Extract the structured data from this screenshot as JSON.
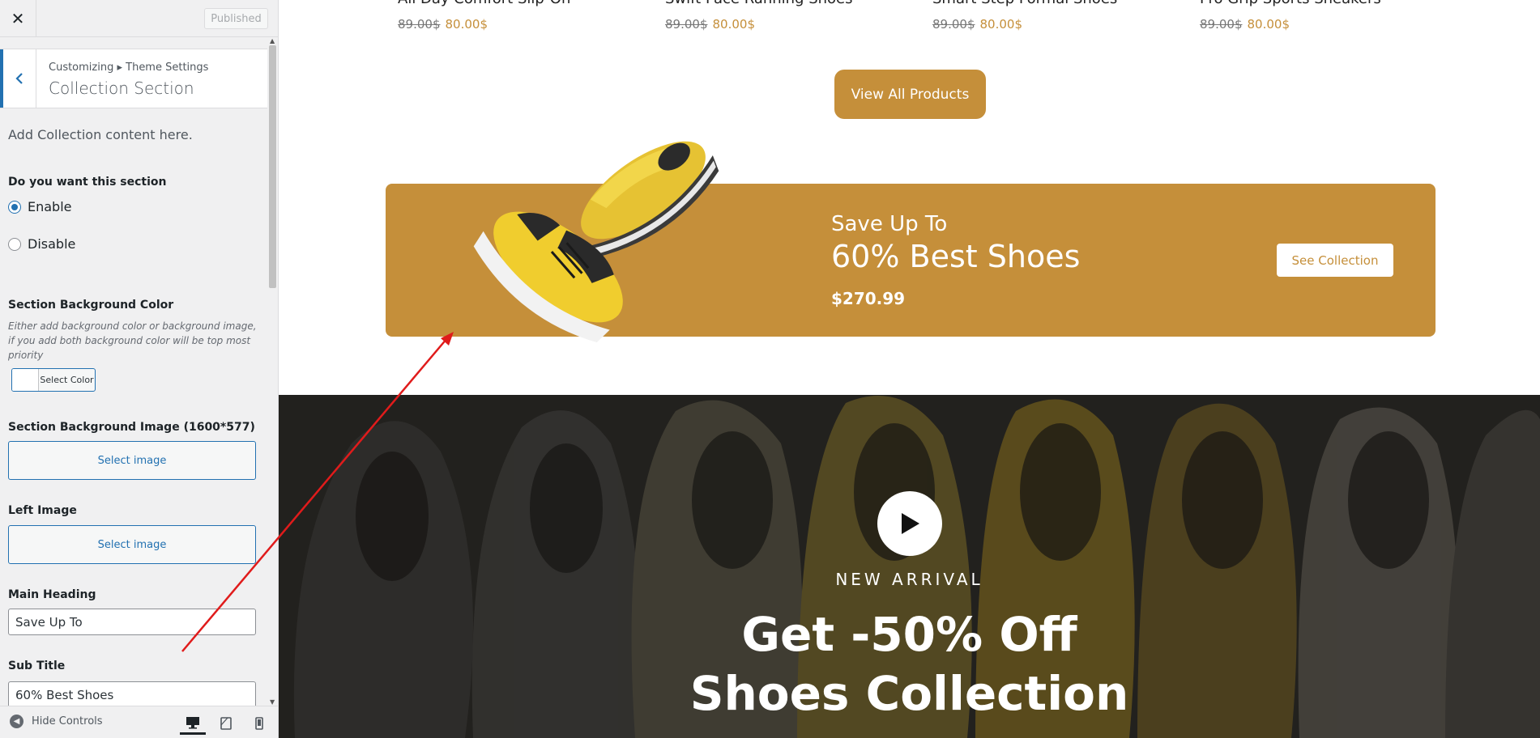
{
  "sidebar": {
    "close_icon": "close-icon",
    "published_label": "Published",
    "breadcrumb": "Customizing ▸ Theme Settings",
    "section_title": "Collection Section",
    "description": "Add Collection content here.",
    "enable_question": "Do you want this section",
    "options": [
      {
        "label": "Enable",
        "checked": true
      },
      {
        "label": "Disable",
        "checked": false
      }
    ],
    "bg_color_label": "Section Background Color",
    "bg_color_help": "Either add background color or background image, if you add both background color will be top most priority",
    "select_color_label": "Select Color",
    "bg_image_label": "Section Background Image (1600*577)",
    "select_image_label": "Select image",
    "left_image_label": "Left Image",
    "main_heading_label": "Main Heading",
    "main_heading_value": "Save Up To",
    "sub_title_label": "Sub Title",
    "sub_title_value": "60% Best Shoes",
    "hide_controls_label": "Hide Controls",
    "accent_color": "#2271b1"
  },
  "preview": {
    "products": [
      {
        "name": "All Day Comfort Slip-On",
        "old_price": "89.00$",
        "new_price": "80.00$"
      },
      {
        "name": "Swift Pace Running Shoes",
        "old_price": "89.00$",
        "new_price": "80.00$"
      },
      {
        "name": "Smart Step Formal Shoes",
        "old_price": "89.00$",
        "new_price": "80.00$"
      },
      {
        "name": "Pro Grip Sports Sneakers",
        "old_price": "89.00$",
        "new_price": "80.00$"
      }
    ],
    "view_all_label": "View All Products",
    "banner": {
      "heading": "Save Up To",
      "sub_title": "60% Best Shoes",
      "price": "$270.99",
      "button_label": "See Collection",
      "color": "#c58f3a"
    },
    "hero": {
      "eyebrow": "NEW ARRIVAL",
      "title_line1": "Get -50% Off",
      "title_line2": "Shoes Collection"
    }
  }
}
